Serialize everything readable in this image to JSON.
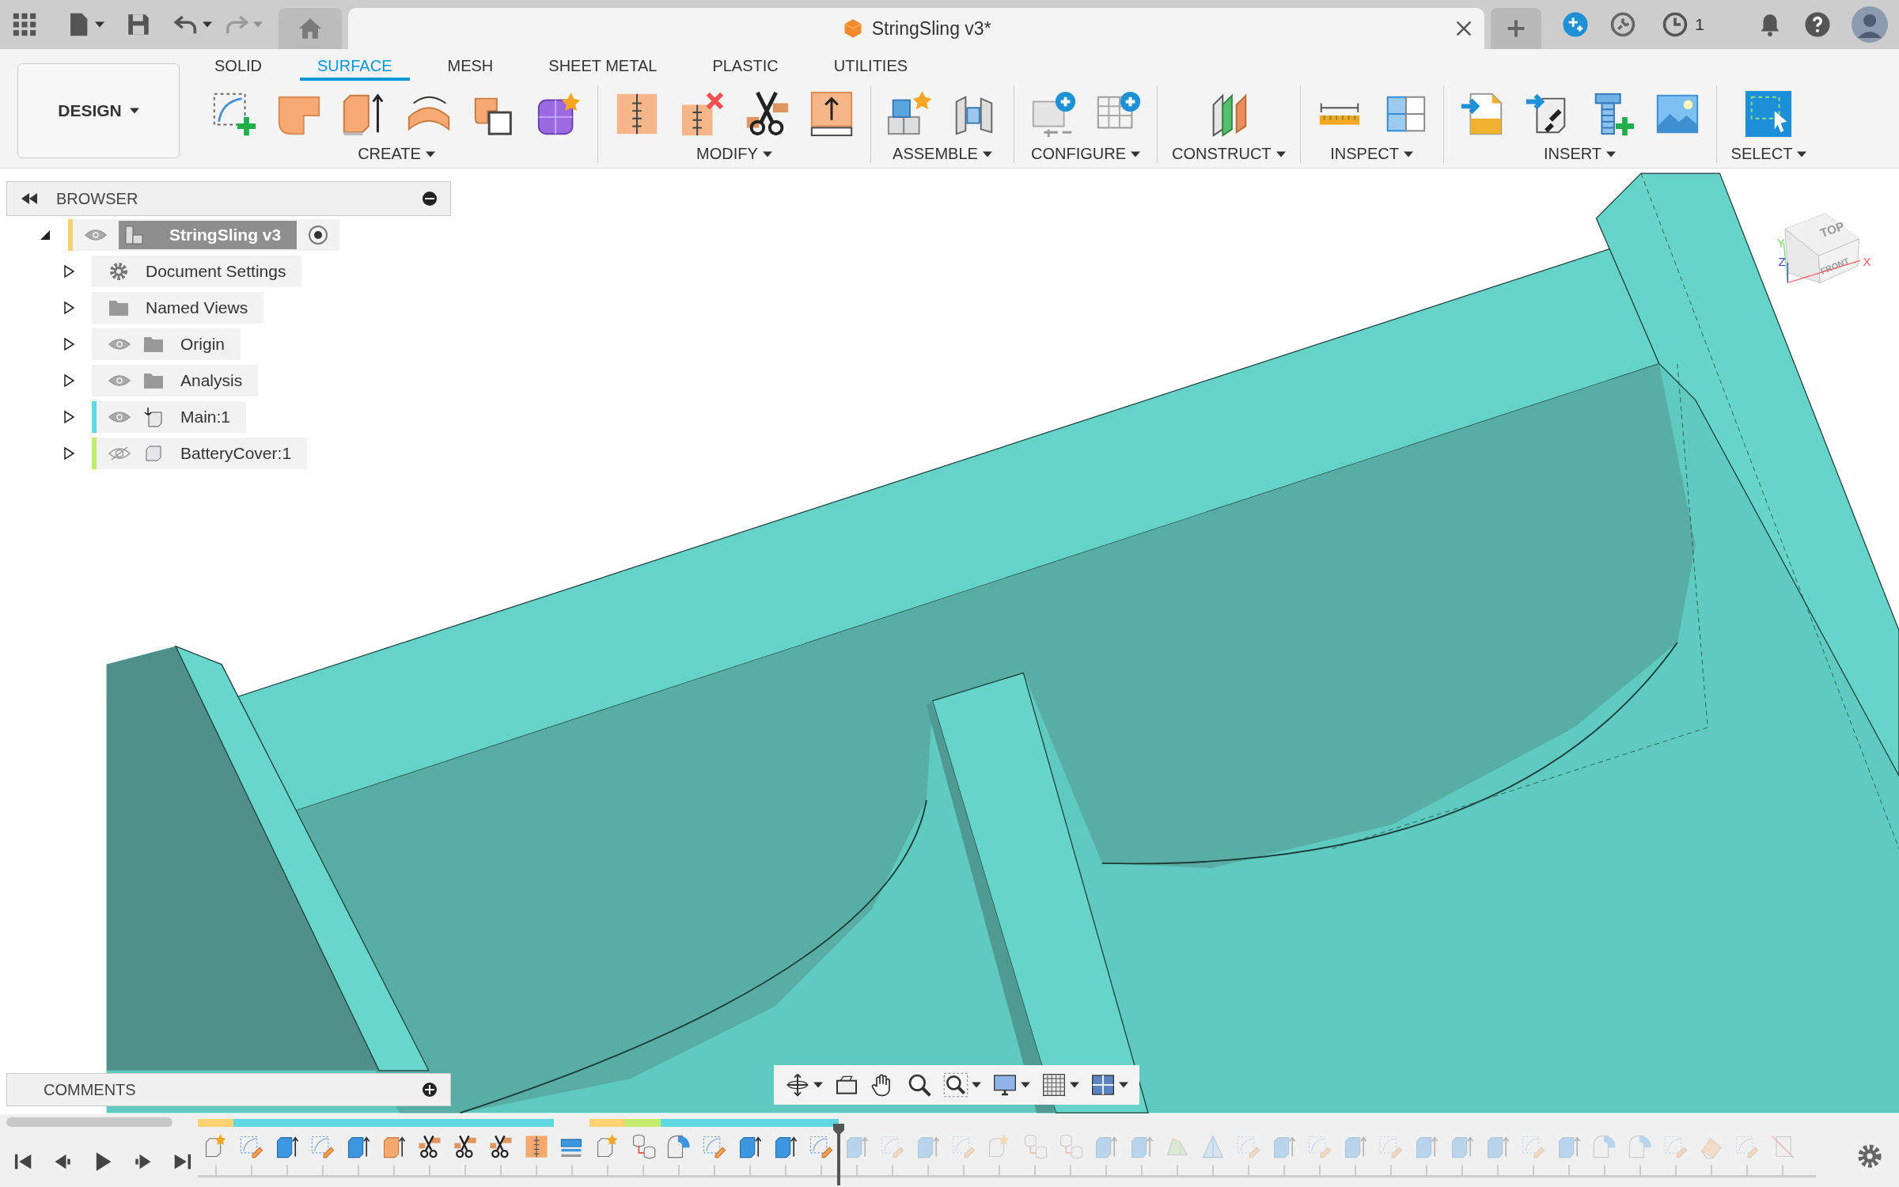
{
  "app_bar": {
    "redo": {
      "disabled": true
    },
    "document_tab": {
      "title": "StringSling v3*"
    },
    "job_count": "1"
  },
  "ribbon": {
    "workspace": "DESIGN",
    "tabs": [
      {
        "label": "SOLID",
        "selected": false
      },
      {
        "label": "SURFACE",
        "selected": true
      },
      {
        "label": "MESH",
        "selected": false
      },
      {
        "label": "SHEET METAL",
        "selected": false
      },
      {
        "label": "PLASTIC",
        "selected": false
      },
      {
        "label": "UTILITIES",
        "selected": false
      }
    ],
    "groups": [
      {
        "label": "CREATE",
        "tools": [
          {
            "kind": "sketch"
          },
          {
            "kind": "patch"
          },
          {
            "kind": "extrude"
          },
          {
            "kind": "revolve"
          },
          {
            "kind": "boundary"
          },
          {
            "kind": "form"
          }
        ]
      },
      {
        "label": "MODIFY",
        "tools": [
          {
            "kind": "stitch"
          },
          {
            "kind": "unstitch"
          },
          {
            "kind": "trim"
          },
          {
            "kind": "thicken"
          }
        ]
      },
      {
        "label": "ASSEMBLE",
        "tools": [
          {
            "kind": "component"
          },
          {
            "kind": "joint"
          }
        ]
      },
      {
        "label": "CONFIGURE",
        "tools": [
          {
            "kind": "configure"
          },
          {
            "kind": "table"
          }
        ]
      },
      {
        "label": "CONSTRUCT",
        "tools": [
          {
            "kind": "plane"
          }
        ]
      },
      {
        "label": "INSPECT",
        "tools": [
          {
            "kind": "measure"
          },
          {
            "kind": "section"
          }
        ]
      },
      {
        "label": "INSERT",
        "tools": [
          {
            "kind": "svg"
          },
          {
            "kind": "link"
          },
          {
            "kind": "fastener"
          },
          {
            "kind": "image"
          }
        ]
      },
      {
        "label": "SELECT",
        "tools": [
          {
            "kind": "select"
          }
        ]
      }
    ]
  },
  "browser": {
    "title": "BROWSER",
    "tree": [
      {
        "label": "StringSling v3",
        "kind": "document",
        "selected": true,
        "expanded": true,
        "visible": true,
        "color": "#f9cf6c",
        "children": [
          {
            "label": "Document Settings",
            "kind": "settings",
            "selected": false,
            "expanded": false
          },
          {
            "label": "Named Views",
            "kind": "folder",
            "selected": false,
            "expanded": false
          },
          {
            "label": "Origin",
            "kind": "folder",
            "selected": false,
            "expanded": false,
            "visible": true
          },
          {
            "label": "Analysis",
            "kind": "folder",
            "selected": false,
            "expanded": false,
            "visible": true
          },
          {
            "label": "Main:1",
            "kind": "anchored-component",
            "selected": false,
            "expanded": false,
            "visible": true,
            "color": "#5cdbe2"
          },
          {
            "label": "BatteryCover:1",
            "kind": "component",
            "selected": false,
            "expanded": false,
            "visible": false,
            "color": "#c3ec6c"
          }
        ]
      }
    ]
  },
  "viewcube": {
    "faces": [
      "TOP",
      "FRONT"
    ],
    "axes": [
      "X",
      "Y",
      "Z"
    ]
  },
  "comments": {
    "title": "COMMENTS"
  },
  "timeline": {
    "features": [
      {
        "kind": "component",
        "rolled_back": false,
        "color": "#fdd372"
      },
      {
        "kind": "sketch",
        "rolled_back": false,
        "color": "#5fd9e0"
      },
      {
        "kind": "extrude",
        "rolled_back": false,
        "color": "#5fd9e0"
      },
      {
        "kind": "sketch",
        "rolled_back": false,
        "color": "#5fd9e0"
      },
      {
        "kind": "extrude",
        "rolled_back": false,
        "color": "#5fd9e0"
      },
      {
        "kind": "surface-extrude",
        "rolled_back": false,
        "color": "#5fd9e0"
      },
      {
        "kind": "split",
        "rolled_back": false,
        "color": "#5fd9e0"
      },
      {
        "kind": "split",
        "rolled_back": false,
        "color": "#5fd9e0"
      },
      {
        "kind": "split",
        "rolled_back": false,
        "color": "#5fd9e0"
      },
      {
        "kind": "split-face",
        "rolled_back": false,
        "color": "#5fd9e0"
      },
      {
        "kind": "offset",
        "rolled_back": false
      },
      {
        "kind": "component",
        "rolled_back": false,
        "color": "#fdd372"
      },
      {
        "kind": "bodies",
        "rolled_back": false,
        "color": "#c3ec6c"
      },
      {
        "kind": "fillet",
        "rolled_back": false,
        "color": "#5fd9e0"
      },
      {
        "kind": "sketch",
        "rolled_back": false,
        "color": "#5fd9e0"
      },
      {
        "kind": "extrude",
        "rolled_back": false,
        "color": "#5fd9e0"
      },
      {
        "kind": "extrude",
        "rolled_back": false,
        "color": "#5fd9e0"
      },
      {
        "kind": "sketch",
        "rolled_back": false,
        "color": "#5fd9e0"
      },
      {
        "kind": "extrude",
        "rolled_back": true
      },
      {
        "kind": "sketch",
        "rolled_back": true
      },
      {
        "kind": "extrude",
        "rolled_back": true
      },
      {
        "kind": "sketch",
        "rolled_back": true
      },
      {
        "kind": "component",
        "rolled_back": true
      },
      {
        "kind": "bodies",
        "rolled_back": true
      },
      {
        "kind": "bodies",
        "rolled_back": true
      },
      {
        "kind": "extrude",
        "rolled_back": true
      },
      {
        "kind": "extrude",
        "rolled_back": true
      },
      {
        "kind": "loft",
        "rolled_back": true
      },
      {
        "kind": "plane",
        "rolled_back": true
      },
      {
        "kind": "sketch",
        "rolled_back": true
      },
      {
        "kind": "extrude",
        "rolled_back": true
      },
      {
        "kind": "sketch",
        "rolled_back": true
      },
      {
        "kind": "extrude",
        "rolled_back": true
      },
      {
        "kind": "sketch",
        "rolled_back": true
      },
      {
        "kind": "extrude",
        "rolled_back": true
      },
      {
        "kind": "extrude",
        "rolled_back": true
      },
      {
        "kind": "extrude",
        "rolled_back": true
      },
      {
        "kind": "sketch",
        "rolled_back": true
      },
      {
        "kind": "extrude",
        "rolled_back": true
      },
      {
        "kind": "fillet",
        "rolled_back": true
      },
      {
        "kind": "fillet",
        "rolled_back": true
      },
      {
        "kind": "sketch",
        "rolled_back": true
      },
      {
        "kind": "paint",
        "rolled_back": true
      },
      {
        "kind": "sketch",
        "rolled_back": true
      },
      {
        "kind": "delete",
        "rolled_back": true
      }
    ]
  }
}
